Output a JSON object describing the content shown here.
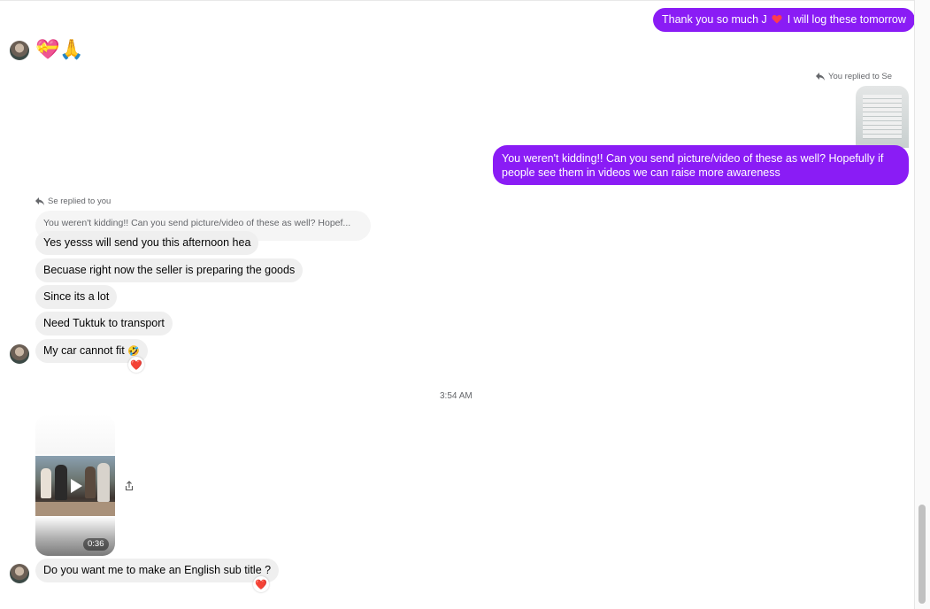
{
  "messages": {
    "m1_text_pre": "Thank you so much J",
    "m1_text_post": "I will log these tomorrow",
    "m2_emojis": "💝🙏",
    "m3_reply_caption": "You replied to Se",
    "m3_text_line1": "You weren't kidding!! Can you send picture/video of these as well? Hopefully if",
    "m3_text_line2": "people see them in videos we can raise more awareness",
    "m4_reply_caption": "Se replied to you",
    "m4_quoted": "You weren't kidding!! Can you send picture/video of these as well? Hopef...",
    "m4_text": "Yes yesss will send you this afternoon hea",
    "m5_text": "Becuase right now the seller is preparing the goods",
    "m6_text": "Since its a lot",
    "m7_text": "Need Tuktuk to transport",
    "m8_text": "My car cannot fit",
    "m8_emoji": "🤣",
    "reaction_heart": "❤️",
    "timestamp": "3:54 AM",
    "video_duration": "0:36",
    "m9_text": "Do you want me to make an English sub title ?"
  },
  "colors": {
    "outgoing_bubble": "#8a1cf5",
    "incoming_bubble": "#efefef",
    "heart": "#e0245e"
  },
  "icons": [
    "reply-arrow-icon",
    "play-icon",
    "share-icon",
    "heart-icon"
  ]
}
